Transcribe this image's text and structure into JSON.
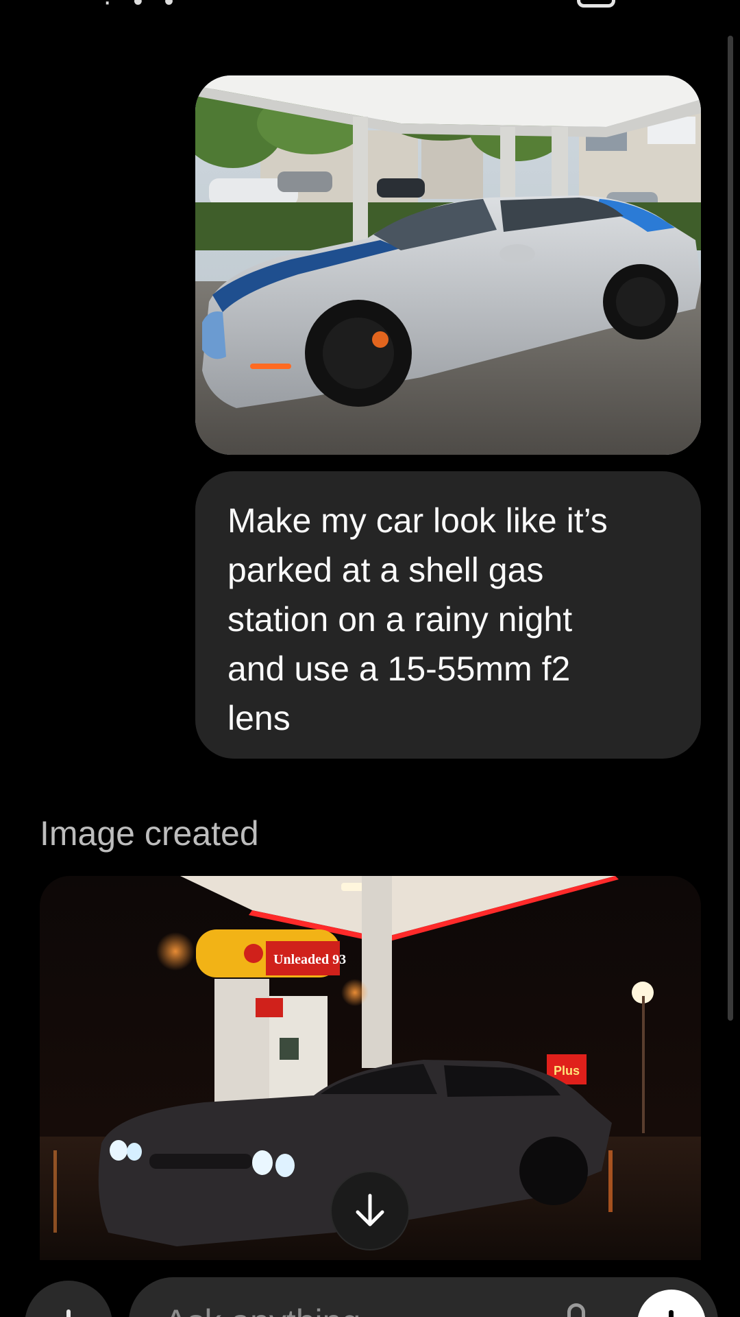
{
  "status_bar": {
    "left_text_partial": "· • •",
    "right_icon": "square-icon"
  },
  "conversation": {
    "user_image": {
      "icon": "photo-attachment",
      "description_visible": false
    },
    "user_message": "Make my car look like it’s\nparked at a shell gas\nstation on a rainy night\nand use a 15-55mm f2\nlens",
    "assistant": {
      "status_label": "Image created",
      "generated_image": {
        "sign_text": "Unleaded 93",
        "price_sign_text": "Plus"
      }
    }
  },
  "scroll_down_button": {
    "icon": "arrow-down-icon"
  },
  "composer": {
    "plus_icon": "plus-icon",
    "placeholder": "Ask anything",
    "mic_icon": "microphone-icon",
    "send_icon": "voice-icon"
  },
  "colors": {
    "background": "#000000",
    "bubble": "#252525",
    "muted_text": "#bdbdbd",
    "shell_yellow": "#f2b316",
    "shell_red": "#d0211b"
  }
}
